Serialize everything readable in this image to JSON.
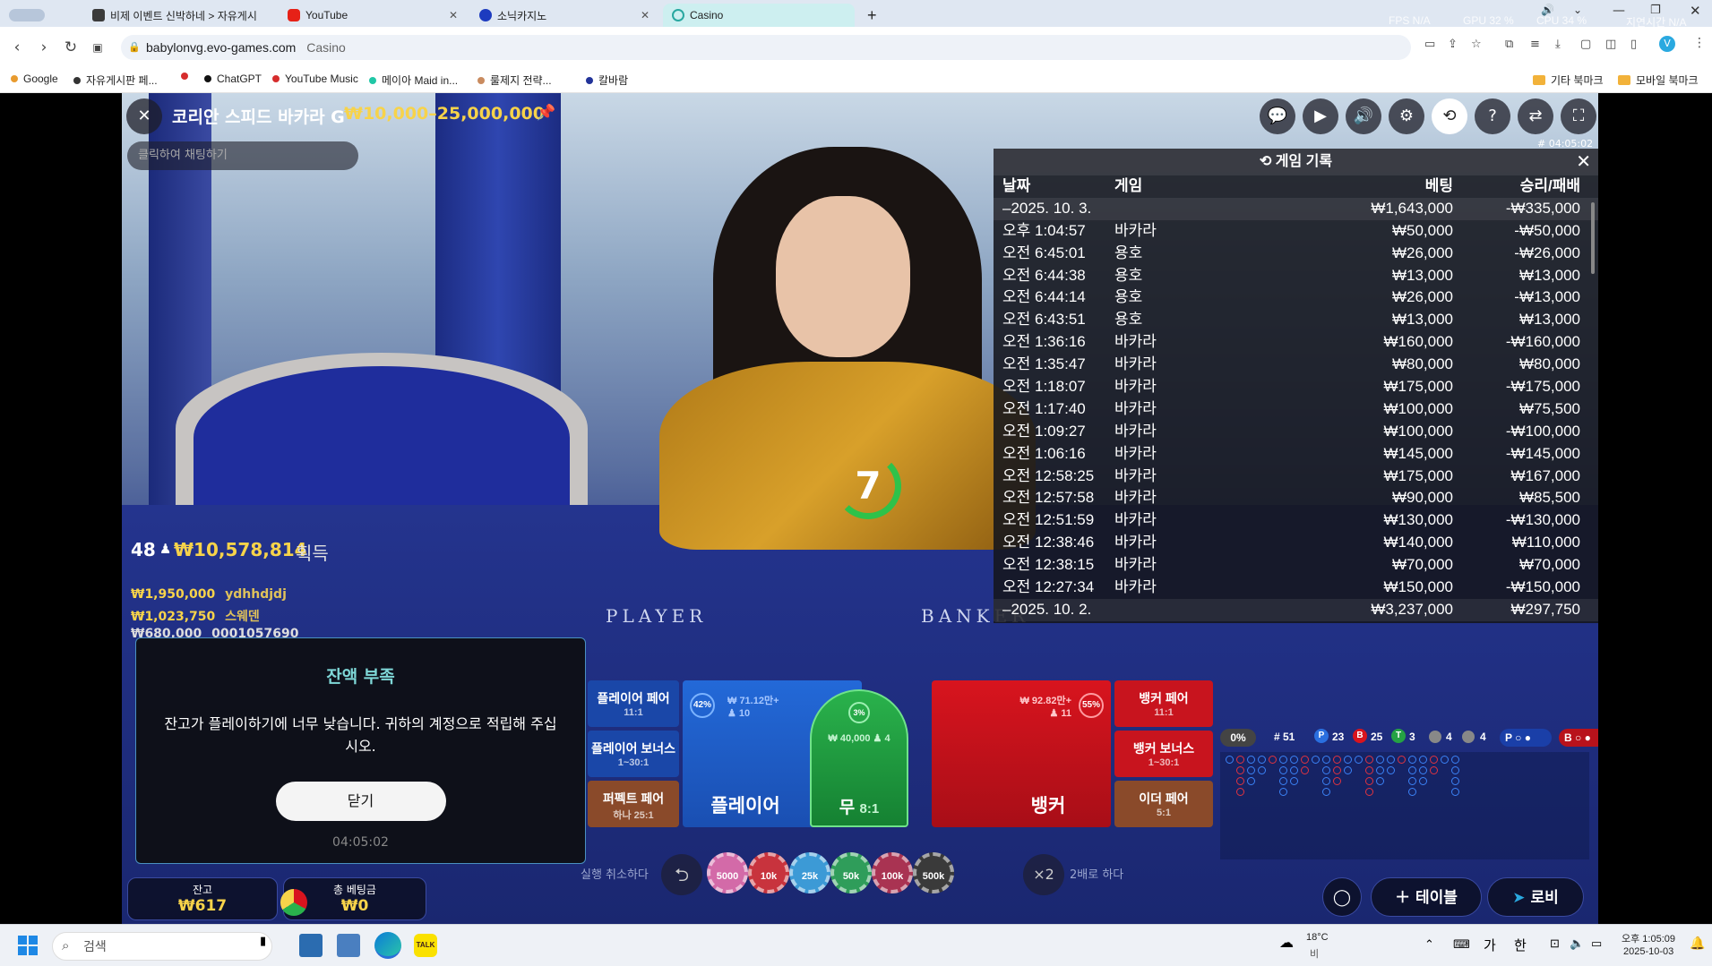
{
  "browser": {
    "tabs": [
      {
        "label": "비제 이벤트 신박하네 > 자유게시",
        "icon": "page-icon"
      },
      {
        "label": "YouTube",
        "icon": "youtube-icon"
      },
      {
        "label": "소닉카지노",
        "icon": "sonic-icon"
      },
      {
        "label": "Casino",
        "icon": "loading-icon",
        "active": true
      }
    ],
    "new_tab": "+",
    "perf": {
      "fps": "FPS N/A",
      "gpu": "GPU 32 %",
      "cpu": "CPU 34 %",
      "lat": "지연시간 N/A"
    },
    "url_host": "babylonvg.evo-games.com",
    "url_title": "Casino",
    "bookmarks": [
      "Google",
      "자유게시판 페...",
      "",
      "ChatGPT",
      "YouTube Music",
      "메이아 Maid in...",
      "룰제지 전략...",
      "칼바람"
    ],
    "bookmark_folders": [
      "기타 북마크",
      "모바일 북마크"
    ],
    "colors": {
      "tabbar": "#dfe7f2",
      "bookmark_dots": [
        "#e89b2f",
        "#333333",
        "#d62d2d",
        "#111111",
        "#d62d2d",
        "#20c7a6",
        "#c98b5f",
        "#223399"
      ]
    }
  },
  "game": {
    "title": "코리안 스피드 바카라 G",
    "limits": "₩10,000–25,000,000",
    "chat_placeholder": "클릭하여 채팅하기",
    "timestamp": "# 04:05:02",
    "timer": "7",
    "winners_count": "48",
    "winners_total": "₩10,578,814",
    "winners_suffix": "획득",
    "winners": [
      {
        "amount": "₩1,950,000",
        "name": "ydhhdjdj"
      },
      {
        "amount": "₩1,023,750",
        "name": "스웨덴"
      },
      {
        "amount": "₩680,000",
        "name": "0001057690"
      }
    ],
    "table_player_label": "PLAYER",
    "table_banker_label": "BANKER",
    "top_icons": [
      "chat-icon",
      "video-icon",
      "volume-icon",
      "settings-icon",
      "history-icon",
      "help-icon",
      "sync-icon",
      "fullscreen-icon"
    ]
  },
  "history": {
    "title": "게임 기록",
    "columns": [
      "날짜",
      "게임",
      "베팅",
      "승리/패배"
    ],
    "rows": [
      {
        "date": "–2025. 10. 3.",
        "game": "",
        "bet": "₩1,643,000",
        "result": "-₩335,000",
        "day": true
      },
      {
        "date": "오후 1:04:57",
        "game": "바카라",
        "bet": "₩50,000",
        "result": "-₩50,000"
      },
      {
        "date": "오전 6:45:01",
        "game": "용호",
        "bet": "₩26,000",
        "result": "-₩26,000"
      },
      {
        "date": "오전 6:44:38",
        "game": "용호",
        "bet": "₩13,000",
        "result": "₩13,000"
      },
      {
        "date": "오전 6:44:14",
        "game": "용호",
        "bet": "₩26,000",
        "result": "-₩13,000"
      },
      {
        "date": "오전 6:43:51",
        "game": "용호",
        "bet": "₩13,000",
        "result": "₩13,000"
      },
      {
        "date": "오전 1:36:16",
        "game": "바카라",
        "bet": "₩160,000",
        "result": "-₩160,000"
      },
      {
        "date": "오전 1:35:47",
        "game": "바카라",
        "bet": "₩80,000",
        "result": "₩80,000"
      },
      {
        "date": "오전 1:18:07",
        "game": "바카라",
        "bet": "₩175,000",
        "result": "-₩175,000"
      },
      {
        "date": "오전 1:17:40",
        "game": "바카라",
        "bet": "₩100,000",
        "result": "₩75,500"
      },
      {
        "date": "오전 1:09:27",
        "game": "바카라",
        "bet": "₩100,000",
        "result": "-₩100,000"
      },
      {
        "date": "오전 1:06:16",
        "game": "바카라",
        "bet": "₩145,000",
        "result": "-₩145,000"
      },
      {
        "date": "오전 12:58:25",
        "game": "바카라",
        "bet": "₩175,000",
        "result": "₩167,000"
      },
      {
        "date": "오전 12:57:58",
        "game": "바카라",
        "bet": "₩90,000",
        "result": "₩85,500"
      },
      {
        "date": "오전 12:51:59",
        "game": "바카라",
        "bet": "₩130,000",
        "result": "-₩130,000"
      },
      {
        "date": "오전 12:38:46",
        "game": "바카라",
        "bet": "₩140,000",
        "result": "₩110,000"
      },
      {
        "date": "오전 12:38:15",
        "game": "바카라",
        "bet": "₩70,000",
        "result": "₩70,000"
      },
      {
        "date": "오전 12:27:34",
        "game": "바카라",
        "bet": "₩150,000",
        "result": "-₩150,000"
      },
      {
        "date": "–2025. 10. 2.",
        "game": "",
        "bet": "₩3,237,000",
        "result": "₩297,750",
        "day": true
      }
    ]
  },
  "bets": {
    "player_pair": {
      "label": "플레이어 페어",
      "odds": "11:1"
    },
    "player_bonus": {
      "label": "플레이어 보너스",
      "odds": "1~30:1"
    },
    "perfect_pair": {
      "label": "퍼펙트 페어",
      "odds": "하나 25:1"
    },
    "player": {
      "label": "플레이어",
      "pct": "42%",
      "amount": "₩ 71.12만+",
      "players": "10"
    },
    "tie": {
      "label": "무",
      "odds": "8:1",
      "pct": "3%",
      "amount": "₩ 40,000",
      "players": "4"
    },
    "banker": {
      "label": "뱅커",
      "pct": "55%",
      "amount": "₩ 92.82만+",
      "players": "11"
    },
    "banker_pair": {
      "label": "뱅커 페어",
      "odds": "11:1"
    },
    "banker_bonus": {
      "label": "뱅커 보너스",
      "odds": "1~30:1"
    },
    "either_pair": {
      "label": "이더 페어",
      "odds": "5:1"
    },
    "colors": {
      "player": "#1f5fc9",
      "banker": "#c8141e",
      "tie": "#1f9b3a",
      "side": "#1a47a8",
      "side_brown": "#8a4a2a"
    }
  },
  "stats": {
    "pct": "0%",
    "round": "# 51",
    "p": "23",
    "b": "25",
    "t": "3",
    "pp": "4",
    "bp": "4",
    "p_ask": "P",
    "b_ask": "B"
  },
  "chips": {
    "undo_label": "실행 취소하다",
    "double_label": "2배로 하다",
    "double_icon": "×2",
    "values": [
      {
        "label": "5000",
        "color": "#d36aa8"
      },
      {
        "label": "10k",
        "color": "#c8333d"
      },
      {
        "label": "25k",
        "color": "#3c9ad6"
      },
      {
        "label": "50k",
        "color": "#2f9d5a"
      },
      {
        "label": "100k",
        "color": "#a93352"
      },
      {
        "label": "500k",
        "color": "#3a3a3a"
      }
    ]
  },
  "balance": {
    "label": "잔고",
    "value": "₩617"
  },
  "total_bet": {
    "label": "총 베팅금",
    "value": "₩0"
  },
  "nav": {
    "table": "테이블",
    "lobby": "로비"
  },
  "dialog": {
    "title": "잔액 부족",
    "message": "잔고가 플레이하기에 너무 낮습니다. 귀하의 계정으로 적립해 주십시오.",
    "button": "닫기",
    "time": "04:05:02"
  },
  "taskbar": {
    "search_placeholder": "검색",
    "weather_temp": "18°C",
    "weather_desc": "비",
    "ime": "가",
    "ime2": "한",
    "time": "오후 1:05:09",
    "date": "2025-10-03"
  }
}
